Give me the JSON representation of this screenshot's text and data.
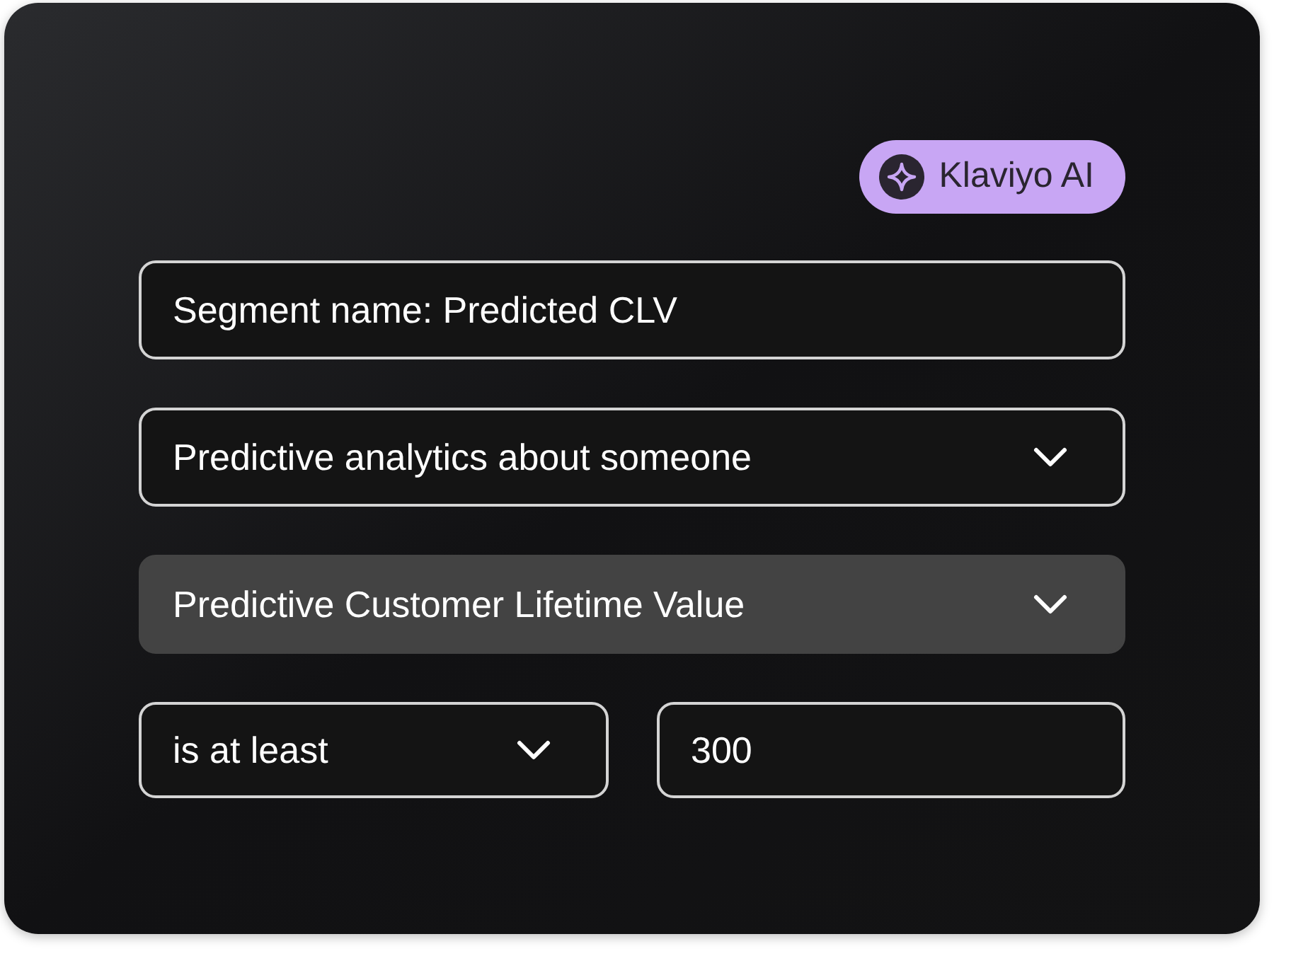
{
  "badge": {
    "label": "Klaviyo AI"
  },
  "fields": [
    {
      "kind": "text",
      "value": "Segment name: Predicted CLV",
      "highlighted": false
    },
    {
      "kind": "select",
      "value": "Predictive analytics about someone",
      "highlighted": false
    },
    {
      "kind": "select",
      "value": "Predictive Customer Lifetime Value",
      "highlighted": true
    }
  ],
  "condition": {
    "operator": {
      "kind": "select",
      "value": "is at least",
      "highlighted": false
    },
    "amount": {
      "kind": "text",
      "value": "300",
      "highlighted": false
    }
  }
}
